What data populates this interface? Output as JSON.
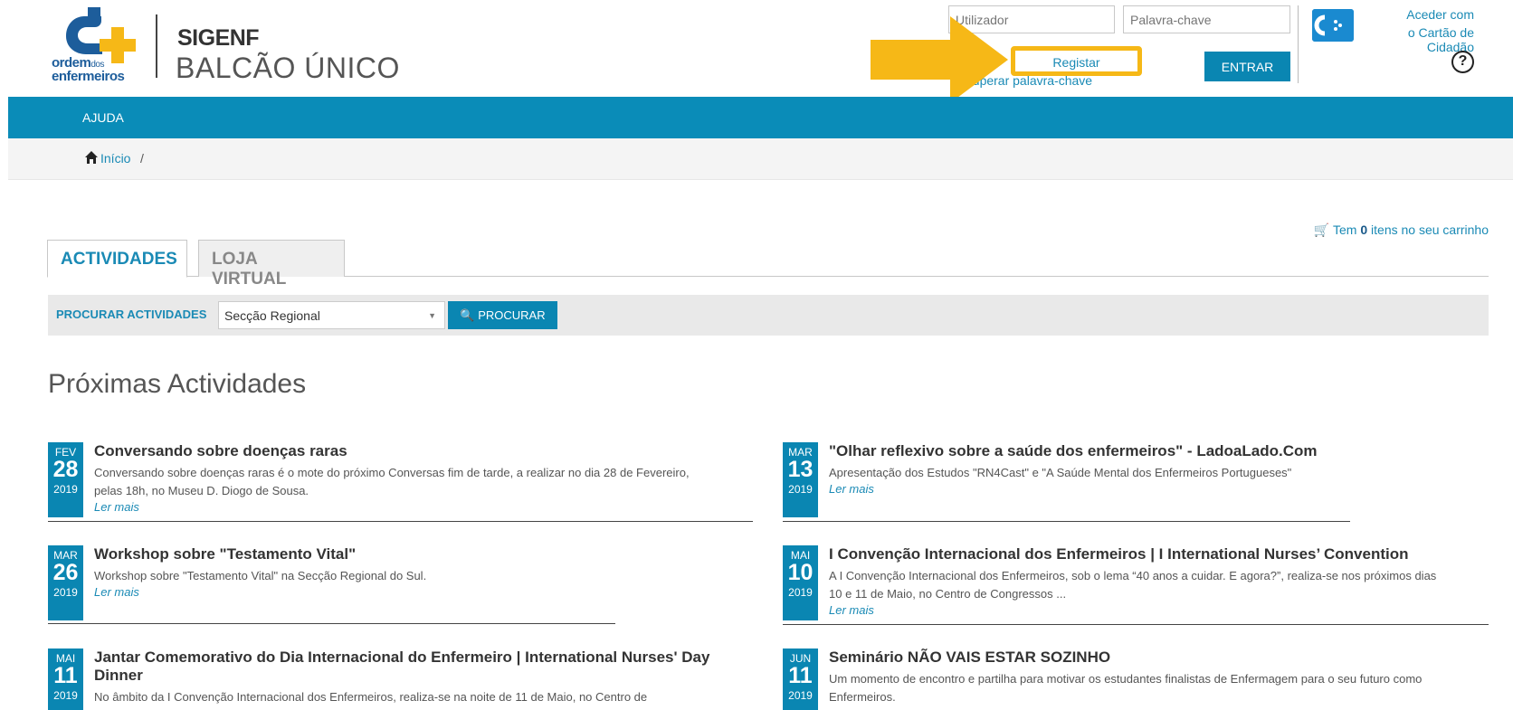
{
  "header": {
    "logo_line1": "ordem",
    "logo_line1_small": "dos",
    "logo_line2": "enfermeiros",
    "brand_title": "SIGENF",
    "brand_subtitle": "BALCÃO ÚNICO",
    "user_placeholder": "Utilizador",
    "password_placeholder": "Palavra-chave",
    "register_label": "Registar",
    "recover_label": "ecuperar palavra-chave",
    "login_label": "ENTRAR",
    "cc_line1": "Aceder com",
    "cc_line2": "o Cartão de Cidadão",
    "help_glyph": "?",
    "highlight_color": "#f6b817"
  },
  "nav": {
    "items": [
      {
        "label": "AJUDA"
      }
    ]
  },
  "breadcrumb": {
    "home_label": "Início",
    "separator": "/"
  },
  "cart": {
    "prefix": "Tem",
    "count": "0",
    "suffix": "itens no seu carrinho"
  },
  "tabs": [
    {
      "label": "ACTIVIDADES",
      "active": true
    },
    {
      "label": "LOJA VIRTUAL",
      "active": false
    }
  ],
  "search": {
    "label": "PROCURAR ACTIVIDADES",
    "select_value": "Secção Regional",
    "button_label": "PROCURAR"
  },
  "section_title": "Próximas Actividades",
  "activities": [
    {
      "month": "FEV",
      "day": "28",
      "year": "2019",
      "title": "Conversando sobre doenças raras",
      "desc1": "Conversando sobre doenças raras é o mote do próximo Conversas fim de tarde, a realizar no dia 28 de Fevereiro,",
      "desc2": "pelas 18h, no Museu D. Diogo de Sousa.",
      "more": "Ler mais"
    },
    {
      "month": "MAR",
      "day": "13",
      "year": "2019",
      "title": "\"Olhar reflexivo sobre a saúde dos enfermeiros\" - LadoaLado.Com",
      "desc1": "Apresentação dos Estudos \"RN4Cast\" e \"A Saúde Mental dos Enfermeiros Portugueses\"",
      "desc2": "",
      "more": "Ler mais"
    },
    {
      "month": "MAR",
      "day": "26",
      "year": "2019",
      "title": "Workshop sobre \"Testamento Vital\"",
      "desc1": "Workshop sobre \"Testamento Vital\" na Secção Regional do Sul.",
      "desc2": "",
      "more": "Ler mais"
    },
    {
      "month": "MAI",
      "day": "10",
      "year": "2019",
      "title": "I Convenção Internacional dos Enfermeiros | I International Nurses’ Convention",
      "desc1": "A I Convenção Internacional dos Enfermeiros, sob o lema “40 anos a cuidar. E agora?”, realiza-se nos próximos dias",
      "desc2": "10 e 11 de Maio, no Centro de Congressos ...",
      "more": "Ler mais"
    },
    {
      "month": "MAI",
      "day": "11",
      "year": "2019",
      "title": "Jantar Comemorativo do Dia Internacional do Enfermeiro | International Nurses' Day",
      "title2": "Dinner",
      "desc1": "No âmbito da I Convenção Internacional dos Enfermeiros, realiza-se na noite de 11 de Maio, no Centro de",
      "desc2": "",
      "more": ""
    },
    {
      "month": "JUN",
      "day": "11",
      "year": "2019",
      "title": "Seminário NÃO VAIS ESTAR SOZINHO",
      "desc1": "Um momento de encontro e partilha para motivar os estudantes finalistas de Enfermagem para o seu futuro como",
      "desc2": "Enfermeiros.",
      "more": ""
    }
  ]
}
